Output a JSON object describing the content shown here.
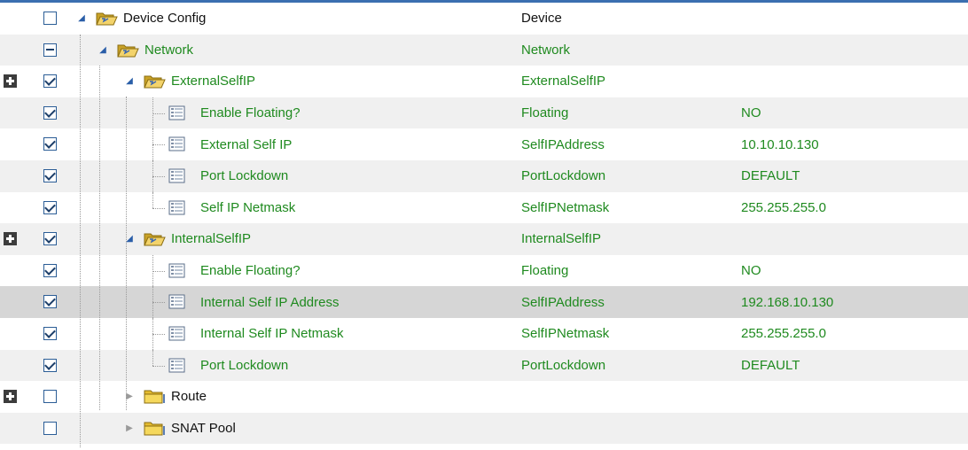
{
  "rows": [
    {
      "level": 0,
      "type": "folder",
      "folder_state": "open",
      "plus": false,
      "check": "unchecked",
      "label": "Device Config",
      "name": "Device",
      "value": "",
      "color": "black",
      "bg": "white",
      "icon": "folder-open-icon"
    },
    {
      "level": 1,
      "type": "folder",
      "folder_state": "open",
      "plus": false,
      "check": "partial",
      "label": "Network",
      "name": "Network",
      "value": "",
      "color": "green",
      "bg": "alt",
      "icon": "folder-open-icon"
    },
    {
      "level": 2,
      "type": "folder",
      "folder_state": "open",
      "plus": true,
      "check": "checked",
      "label": "ExternalSelfIP",
      "name": "ExternalSelfIP",
      "value": "",
      "color": "green",
      "bg": "white",
      "icon": "folder-open-icon"
    },
    {
      "level": 3,
      "type": "item",
      "plus": false,
      "check": "checked",
      "label": "Enable Floating?",
      "name": "Floating",
      "value": "NO",
      "color": "green",
      "bg": "alt",
      "icon": "list-item-icon",
      "last": false
    },
    {
      "level": 3,
      "type": "item",
      "plus": false,
      "check": "checked",
      "label": "External Self IP",
      "name": "SelfIPAddress",
      "value": "10.10.10.130",
      "color": "green",
      "bg": "white",
      "icon": "list-item-icon",
      "last": false
    },
    {
      "level": 3,
      "type": "item",
      "plus": false,
      "check": "checked",
      "label": "Port Lockdown",
      "name": "PortLockdown",
      "value": "DEFAULT",
      "color": "green",
      "bg": "alt",
      "icon": "list-item-icon",
      "last": false
    },
    {
      "level": 3,
      "type": "item",
      "plus": false,
      "check": "checked",
      "label": "Self IP Netmask",
      "name": "SelfIPNetmask",
      "value": "255.255.255.0",
      "color": "green",
      "bg": "white",
      "icon": "list-item-icon",
      "last": true
    },
    {
      "level": 2,
      "type": "folder",
      "folder_state": "open",
      "plus": true,
      "check": "checked",
      "label": "InternalSelfIP",
      "name": "InternalSelfIP",
      "value": "",
      "color": "green",
      "bg": "alt",
      "icon": "folder-open-icon"
    },
    {
      "level": 3,
      "type": "item",
      "plus": false,
      "check": "checked",
      "label": "Enable Floating?",
      "name": "Floating",
      "value": "NO",
      "color": "green",
      "bg": "white",
      "icon": "list-item-icon",
      "last": false
    },
    {
      "level": 3,
      "type": "item",
      "plus": false,
      "check": "checked",
      "label": "Internal Self IP Address",
      "name": "SelfIPAddress",
      "value": "192.168.10.130",
      "color": "green",
      "bg": "sel",
      "icon": "list-item-icon",
      "last": false
    },
    {
      "level": 3,
      "type": "item",
      "plus": false,
      "check": "checked",
      "label": "Internal Self IP Netmask",
      "name": "SelfIPNetmask",
      "value": "255.255.255.0",
      "color": "green",
      "bg": "white",
      "icon": "list-item-icon",
      "last": false
    },
    {
      "level": 3,
      "type": "item",
      "plus": false,
      "check": "checked",
      "label": "Port Lockdown",
      "name": "PortLockdown",
      "value": "DEFAULT",
      "color": "green",
      "bg": "alt",
      "icon": "list-item-icon",
      "last": true
    },
    {
      "level": 2,
      "type": "folder",
      "folder_state": "closed",
      "plus": true,
      "check": "unchecked",
      "label": "Route",
      "name": "",
      "value": "",
      "color": "black",
      "bg": "white",
      "icon": "folder-closed-icon"
    },
    {
      "level": 2,
      "type": "folder",
      "folder_state": "closed",
      "plus": false,
      "check": "unchecked",
      "label": "SNAT Pool",
      "name": "",
      "value": "",
      "color": "black",
      "bg": "alt",
      "icon": "folder-closed-icon"
    }
  ]
}
